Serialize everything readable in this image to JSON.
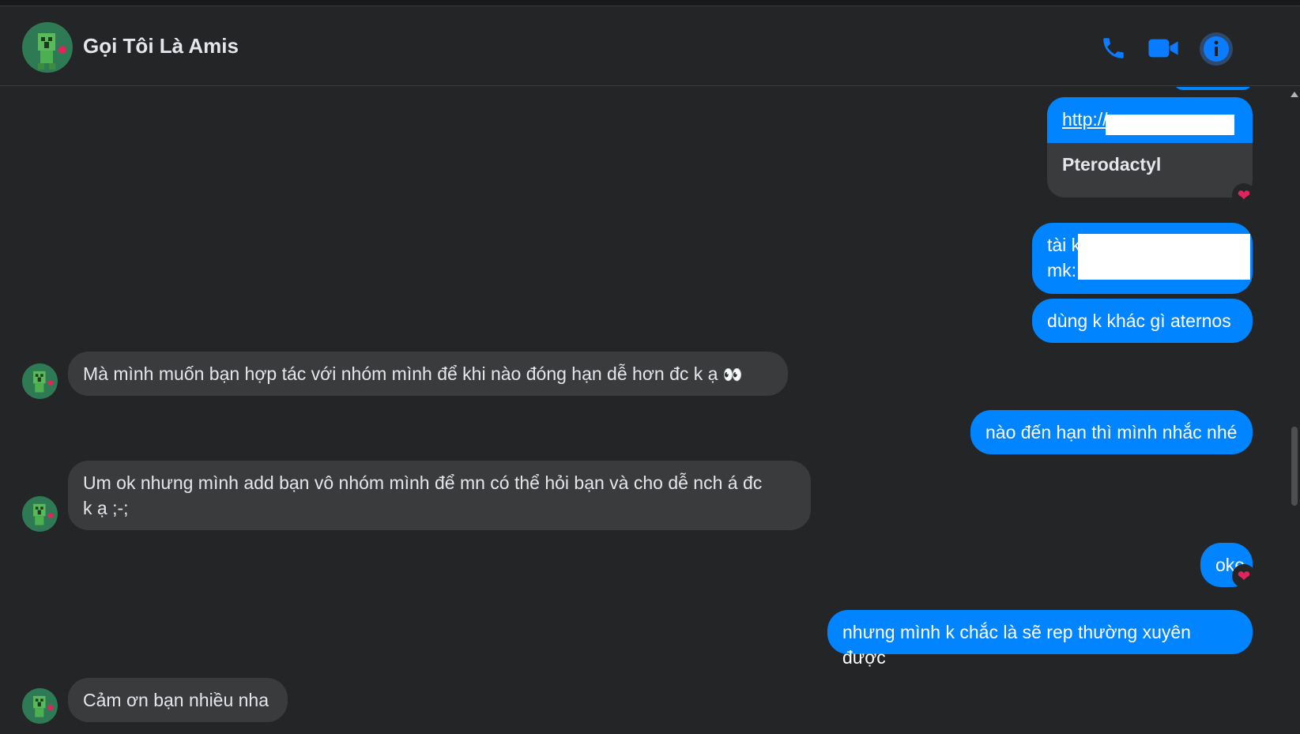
{
  "header": {
    "contact_name": "Gọi Tôi Là Amis",
    "icons": [
      "phone-icon",
      "video-camera-icon",
      "info-icon"
    ]
  },
  "colors": {
    "outgoing_bubble": "#0084ff",
    "incoming_bubble": "#3a3b3c",
    "background": "#242526",
    "accent": "#0084ff",
    "reaction": "#e0245e"
  },
  "messages": {
    "link_card": {
      "url": "http://",
      "title": "Pterodactyl"
    },
    "account_info": {
      "line1": "tài k",
      "line2": "mk:"
    },
    "msg_aternos": "dùng k khác gì aternos",
    "msg_cooperate": "Mà mình muốn bạn hợp tác với nhóm mình để khi nào đóng hạn dễ hơn đc k ạ",
    "msg_cooperate_emoji": "👀",
    "msg_remind": "nào đến hạn thì mình nhắc nhé",
    "msg_add_group_line1": "Um ok nhưng mình add bạn vô nhóm mình để mn có thể hỏi bạn và cho dễ nch á đc",
    "msg_add_group_line2": "k ạ ;-;",
    "msg_oke": "oke",
    "msg_not_sure": "nhưng mình k chắc là sẽ rep thường xuyên được",
    "msg_thanks": "Cảm ơn bạn nhiều nha",
    "reaction": "❤"
  }
}
